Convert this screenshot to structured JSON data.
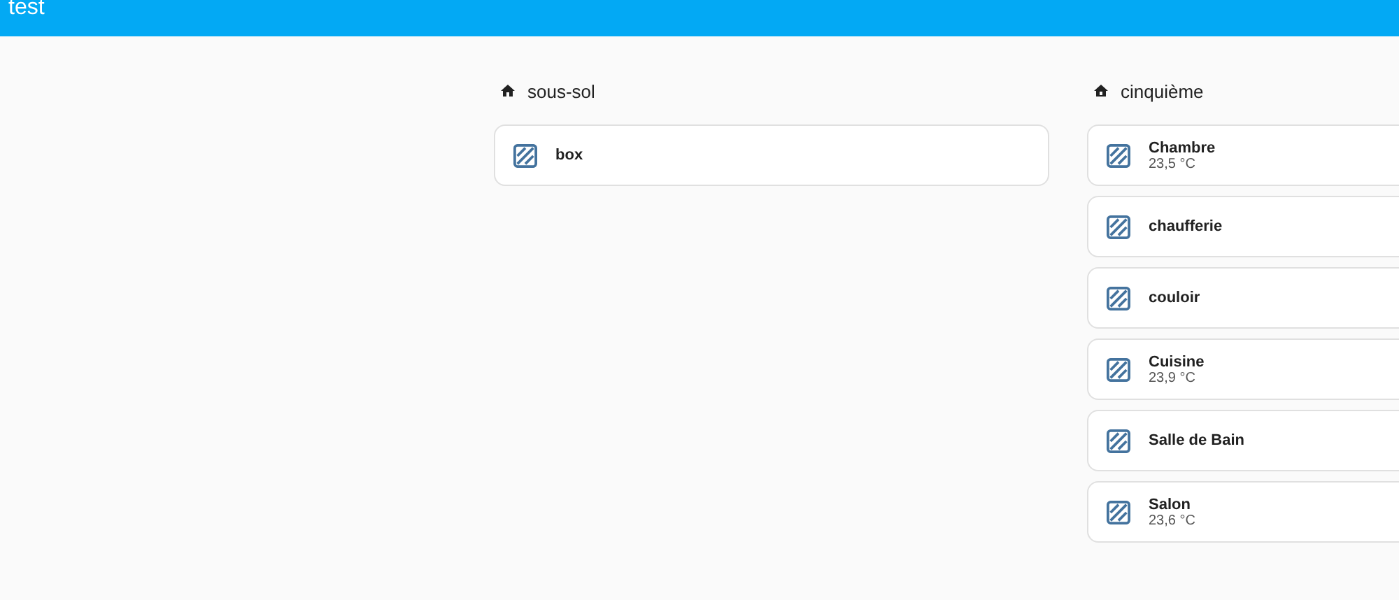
{
  "header": {
    "title": "test"
  },
  "sections": [
    {
      "title": "sous-sol",
      "items": [
        {
          "name": "box"
        }
      ]
    },
    {
      "title": "cinquième",
      "items": [
        {
          "name": "Chambre",
          "reading": "23,5 °C"
        },
        {
          "name": "chaufferie"
        },
        {
          "name": "couloir"
        },
        {
          "name": "Cuisine",
          "reading": "23,9 °C"
        },
        {
          "name": "Salle de Bain"
        },
        {
          "name": "Salon",
          "reading": "23,6 °C"
        }
      ]
    }
  ]
}
